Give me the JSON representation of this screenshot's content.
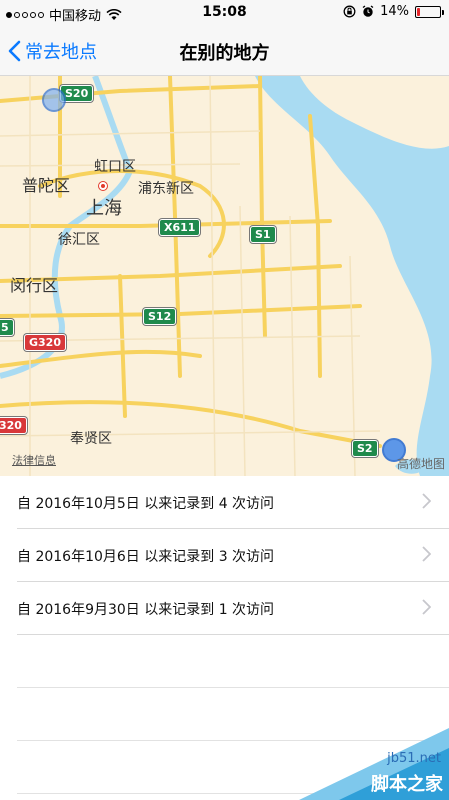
{
  "status_bar": {
    "carrier": "中国移动",
    "time": "15:08",
    "battery": "14%",
    "battery_level": 0.14
  },
  "nav": {
    "back_label": "常去地点",
    "title": "在别的地方"
  },
  "map": {
    "labels": {
      "putuo": "普陀区",
      "hongkou": "虹口区",
      "pudong": "浦东新区",
      "shanghai": "上海",
      "xuhui": "徐汇区",
      "minhang": "闵行区",
      "fengxian": "奉贤区"
    },
    "highways": {
      "s20": "S20",
      "x611": "X611",
      "s1": "S1",
      "s12": "S12",
      "g320": "G320",
      "s2": "S2",
      "g320b": "320",
      "s5": "5"
    },
    "legal": "法律信息",
    "logo": "高德地图",
    "colors": {
      "water": "#a9dbf2",
      "land": "#fbf1dc",
      "road": "#f7d25e",
      "green_shield": "#1f8a4c",
      "red_shield": "#d8383a",
      "pin": "#4d8eea"
    }
  },
  "visits": [
    {
      "text": "自 2016年10月5日 以来记录到 4 次访问"
    },
    {
      "text": "自 2016年10月6日 以来记录到 3 次访问"
    },
    {
      "text": "自 2016年9月30日 以来记录到 1 次访问"
    }
  ],
  "watermark": {
    "url": "jb51.net",
    "name": "脚本之家"
  }
}
